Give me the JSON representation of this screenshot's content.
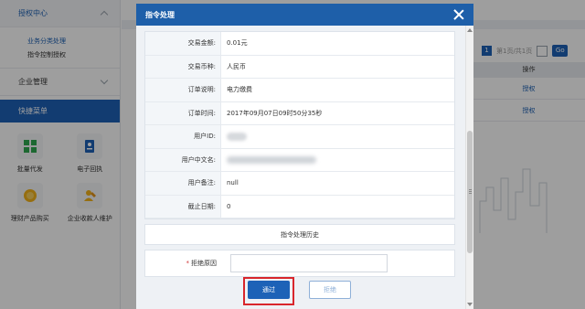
{
  "sidebar": {
    "menu_auth": "授权中心",
    "sub_items": [
      "业务分类处理",
      "指令控制授权"
    ],
    "menu_enterprise": "企业管理",
    "quick_menu": "快捷菜单",
    "quick_items": [
      {
        "label": "批量代发",
        "icon": "grid-icon"
      },
      {
        "label": "电子回执",
        "icon": "receipt-icon"
      },
      {
        "label": "理财产品购买",
        "icon": "coin-icon"
      },
      {
        "label": "企业收款人维护",
        "icon": "payee-icon"
      }
    ]
  },
  "background_page": {
    "pager": {
      "current_page": "1",
      "summary": "第1页/共1页",
      "go": "Go"
    },
    "table": {
      "header": "操作",
      "rows": [
        "授权",
        "授权"
      ]
    }
  },
  "modal": {
    "title": "指令处理",
    "fields": [
      {
        "label": "交易金额:",
        "value": "0.01元"
      },
      {
        "label": "交易币种:",
        "value": "人民币"
      },
      {
        "label": "订单说明:",
        "value": "电力缴费"
      },
      {
        "label": "订单时间:",
        "value": "2017年09月07日09时50分35秒"
      },
      {
        "label": "用户ID:",
        "value": ""
      },
      {
        "label": "用户中文名:",
        "value": ""
      },
      {
        "label": "用户备注:",
        "value": "null"
      },
      {
        "label": "截止日期:",
        "value": "0"
      }
    ],
    "history_button": "指令处理历史",
    "reject_reason": {
      "required_mark": "*",
      "label": "拒绝原因",
      "value": ""
    },
    "pass_button": "通过",
    "reject_button": "拒绝"
  },
  "colors": {
    "primary": "#1d62b7",
    "header": "#1e5fa9",
    "highlight": "#d9262c"
  }
}
